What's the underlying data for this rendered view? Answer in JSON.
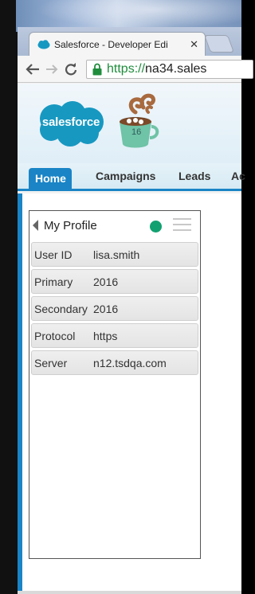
{
  "browser": {
    "tab_title": "Salesforce - Developer Edi",
    "url_scheme": "https://",
    "url_rest": "na34.sales"
  },
  "salesforce": {
    "logo_text": "salesforce",
    "mascot_badge": "16",
    "nav_tabs": [
      {
        "label": "Home"
      },
      {
        "label": "Campaigns"
      },
      {
        "label": "Leads"
      },
      {
        "label": "Ac"
      }
    ]
  },
  "profile_widget": {
    "title": "My Profile",
    "status_color": "#12a070",
    "rows": [
      {
        "key": "User ID",
        "value": "lisa.smith"
      },
      {
        "key": "Primary",
        "value": "2016"
      },
      {
        "key": "Secondary",
        "value": "2016"
      },
      {
        "key": "Protocol",
        "value": "https"
      },
      {
        "key": "Server",
        "value": "n12.tsdqa.com"
      }
    ]
  },
  "colors": {
    "accent": "#1a84c6",
    "secure_green": "#1f8c3c"
  }
}
